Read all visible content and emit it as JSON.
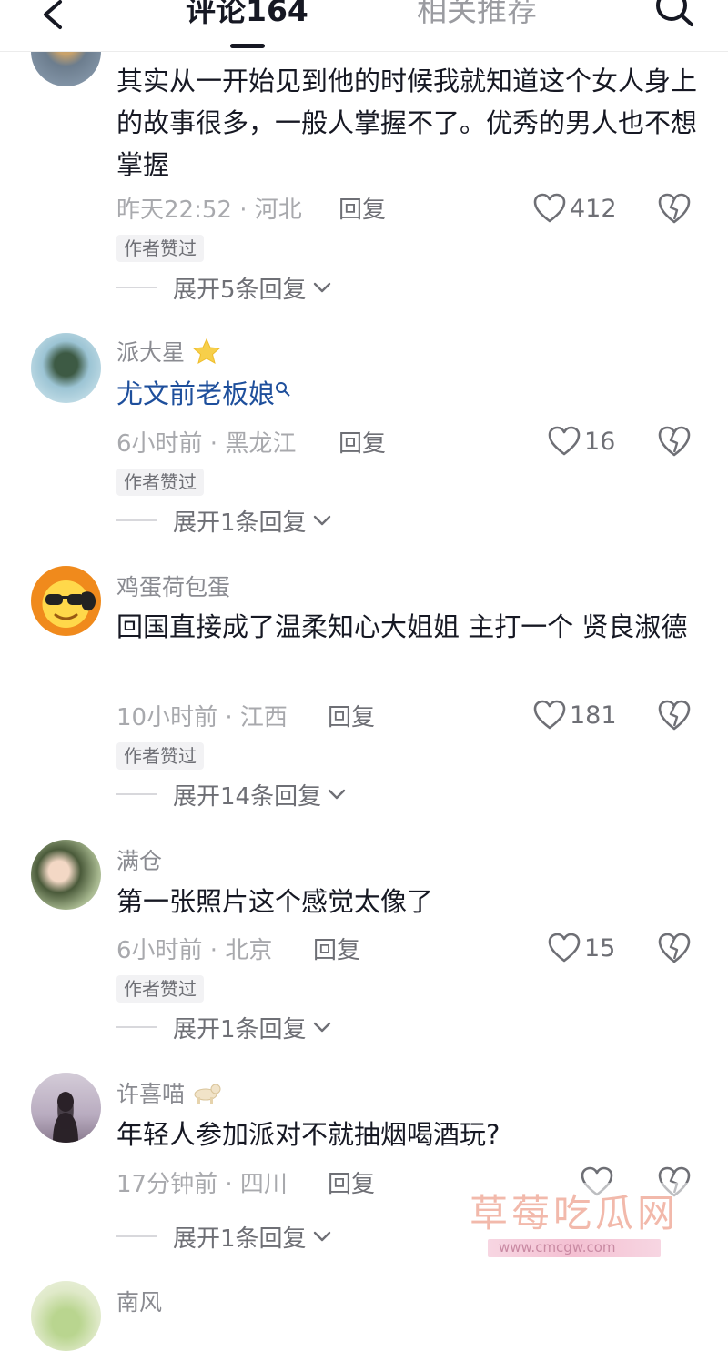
{
  "header": {
    "tab_comments": "评论164",
    "tab_related": "相关推荐"
  },
  "colors": {
    "link": "#1e4f9c",
    "secondary_text": "#a8a9ad",
    "badge_bg": "#f2f2f4"
  },
  "comments": [
    {
      "username": "",
      "content": "其实从一开始见到他的时候我就知道这个女人身上的故事很多，一般人掌握不了。优秀的男人也不想掌握",
      "time": "昨天22:52",
      "location": "河北",
      "reply_label": "回复",
      "likes": "412",
      "badge": "作者赞过",
      "expand": "展开5条回复"
    },
    {
      "username": "派大星",
      "username_icon": "star-emoji",
      "content": "尤文前老板娘",
      "time": "6小时前",
      "location": "黑龙江",
      "reply_label": "回复",
      "likes": "16",
      "badge": "作者赞过",
      "expand": "展开1条回复"
    },
    {
      "username": "鸡蛋荷包蛋",
      "content": "回国直接成了温柔知心大姐姐 主打一个 贤良淑德",
      "time": "10小时前",
      "location": "江西",
      "reply_label": "回复",
      "likes": "181",
      "badge": "作者赞过",
      "expand": "展开14条回复"
    },
    {
      "username": "满仓",
      "content": "第一张照片这个感觉太像了",
      "time": "6小时前",
      "location": "北京",
      "reply_label": "回复",
      "likes": "15",
      "badge": "作者赞过",
      "expand": "展开1条回复"
    },
    {
      "username": "许喜喵",
      "username_icon": "dog-emoji",
      "content": "年轻人参加派对不就抽烟喝酒玩?",
      "time": "17分钟前",
      "location": "四川",
      "reply_label": "回复",
      "expand": "展开1条回复"
    },
    {
      "username": "南风"
    }
  ],
  "meta_separator": " · ",
  "watermark": {
    "title": "草莓吃瓜网",
    "url": "www.cmcgw.com"
  }
}
